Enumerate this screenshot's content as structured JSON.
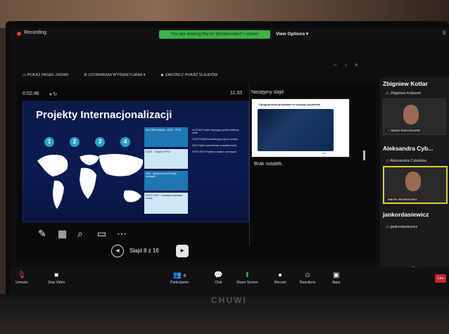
{
  "recording": {
    "label": "Recording"
  },
  "banner": {
    "text": "You are viewing Marcin Wozbenowicz's screen"
  },
  "view_options": "View Options ▾",
  "presenter_tools": [
    "POKAŻ PASEK ZADAŃ",
    "USTAWIENIA WYŚWIETLANIA ▾",
    "ZAKOŃCZ POKAZ SLAJDÓW"
  ],
  "timer": "0:02:46",
  "clock": "11:33",
  "next_slide_label": "Następny slajd",
  "next_slide_title": "Udogodnienia przydatne w rozwoju projektów",
  "notes": "Brak notatek.",
  "slide": {
    "title": "Projekty Internacjonalizacji",
    "steps": [
      "1",
      "2",
      "3",
      "4"
    ],
    "boxes": [
      "AUCOMI Kraków · 2010 · PPGI",
      "CAVE · Ciaprim PPGI",
      "ZEA · Zjednoczone Emiraty Arabskie",
      "EXPO 2020 · Światowa wystawa Dubaj"
    ],
    "descriptions": [
      "AUCOMI Projekt skupiający spółki polskiego rynku.",
      "CAVE Projekt koncentrujący się na rozwoju.",
      "ZEA Projekt uczestnictwa w wydarzeniach.",
      "EXPO 2020 Projekty z regionu promujące."
    ]
  },
  "slide_nav": {
    "counter": "Slajd 8 z 16"
  },
  "participants_panel": {
    "header_name": "Zbigniew Kotlar",
    "entries": [
      {
        "big": "Zbigniew Kotlar...",
        "small": "Zbigniew Kotlarek",
        "tile_label": "Marek Świeczkowski"
      },
      {
        "big": "Aleksandra Cyb...",
        "small": "Aleksandra Cybulska",
        "tile_label": "Marcin Wozbenowicz"
      },
      {
        "big": "jankordasiewicz",
        "small": "jankordasiewicz"
      }
    ]
  },
  "toolbar": {
    "unmute": "Unmute",
    "stop_video": "Stop Video",
    "participants": "Participants",
    "participants_count": "6",
    "chat": "Chat",
    "share_screen": "Share Screen",
    "record": "Record",
    "reactions": "Reactions",
    "apps": "Apps",
    "leave": "Lea"
  },
  "brand": "CHUWI",
  "colors": {
    "banner_green": "#3cb54a",
    "active_speaker": "#d9d231",
    "leave_red": "#c42a2a"
  }
}
